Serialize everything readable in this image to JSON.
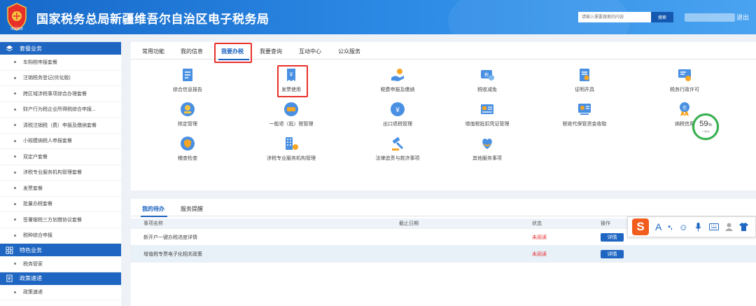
{
  "header": {
    "emblem_caption": "中国税务",
    "title": "国家税务总局新疆维吾尔自治区电子税务局",
    "search_placeholder": "请输入需要搜索的内容",
    "search_button": "搜索",
    "logout": "退出"
  },
  "sidebar": {
    "sections": [
      {
        "title": "套餐业务",
        "icon": "stack-icon",
        "items": [
          "车购税申报套餐",
          "注销税务登记(优化版)",
          "跨区域涉税事项综合办理套餐",
          "财产行为税企业所得税综合申报...",
          "清税注销税（费）申报及缴纳套餐",
          "小规模纳税人申报套餐",
          "双定户套餐",
          "涉税专业服务机构管理套餐",
          "发票套餐",
          "批量办税套餐",
          "签署银税三方划缴协议套餐",
          "税种综合申报"
        ]
      },
      {
        "title": "特色业务",
        "icon": "grid-icon",
        "items": [
          "税务管家"
        ]
      },
      {
        "title": "政策速递",
        "icon": "document-icon",
        "items": [
          "政策速递"
        ]
      }
    ]
  },
  "tabs": [
    "常用功能",
    "我的信息",
    "我要办税",
    "我要查询",
    "互动中心",
    "公众服务"
  ],
  "active_tab": "我要办税",
  "services": [
    {
      "label": "综合信息报告",
      "icon": "report-icon"
    },
    {
      "label": "发票使用",
      "icon": "invoice-icon"
    },
    {
      "label": "税费申报及缴纳",
      "icon": "payment-icon"
    },
    {
      "label": "税收减免",
      "icon": "tax-reduction-icon"
    },
    {
      "label": "证明开具",
      "icon": "certificate-icon"
    },
    {
      "label": "税务行政许可",
      "icon": "permit-icon"
    },
    {
      "label": "核定管理",
      "icon": "assessment-icon"
    },
    {
      "label": "一般退（抵）税管理",
      "icon": "refund-icon"
    },
    {
      "label": "出口退税管理",
      "icon": "export-refund-icon"
    },
    {
      "label": "增值税抵扣凭证管理",
      "icon": "vat-voucher-icon"
    },
    {
      "label": "税收代保管资金收取",
      "icon": "custody-fund-icon"
    },
    {
      "label": "纳税信用",
      "icon": "credit-icon"
    },
    {
      "label": "稽查检查",
      "icon": "inspection-icon"
    },
    {
      "label": "涉税专业服务机构管理",
      "icon": "agency-icon"
    },
    {
      "label": "法律追责与救济事项",
      "icon": "legal-icon"
    },
    {
      "label": "其他服务事项",
      "icon": "other-services-icon"
    }
  ],
  "credit_badge": {
    "percent": "59",
    "unit": "%",
    "sub": "↑ 0K/s"
  },
  "todo": {
    "tabs": [
      "我的待办",
      "服务提醒"
    ],
    "columns": [
      "事项名称",
      "截止日期",
      "状态",
      "操作"
    ],
    "rows": [
      {
        "name": "新开户一键办税进度详情",
        "deadline": "",
        "status": "未阅读",
        "action": "详情"
      },
      {
        "name": "增值税专票电子化相关政策",
        "deadline": "",
        "status": "未阅读",
        "action": "详情"
      }
    ]
  },
  "ime_toolbar": {
    "logo": "S",
    "items": [
      "A",
      "•,",
      "☺",
      "🎤",
      "⌨",
      "👤",
      "👕"
    ]
  },
  "colors": {
    "header": "#1769c9",
    "sidebar_section": "#1f66c2",
    "accent": "#1a62c0",
    "highlight": "#e8302a",
    "unread": "#e62a2a"
  }
}
